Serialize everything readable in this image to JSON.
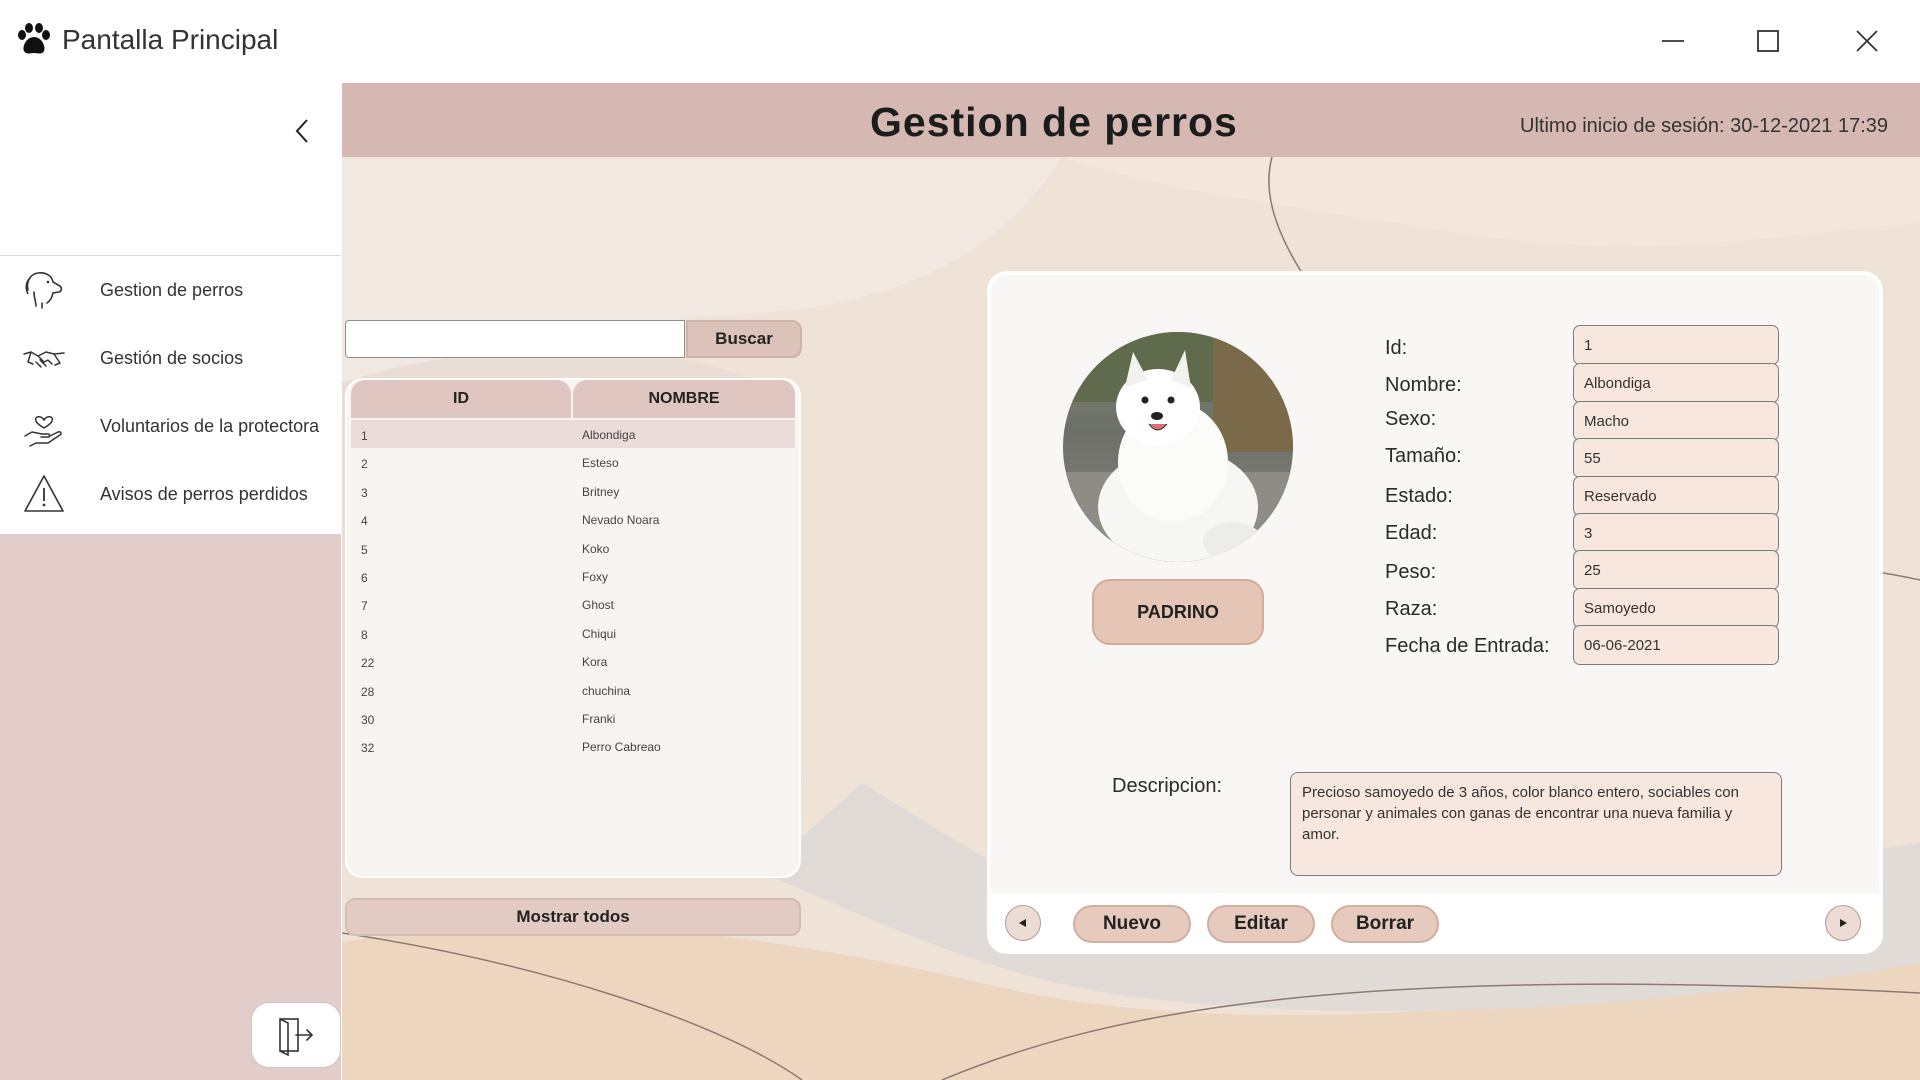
{
  "window": {
    "title": "Pantalla Principal",
    "icons": [
      "paw-icon",
      "minimize-icon",
      "maximize-icon",
      "close-icon"
    ]
  },
  "sidebar": {
    "items": [
      {
        "label": "Gestion de perros",
        "icon": "dog-icon"
      },
      {
        "label": "Gestión de socios",
        "icon": "handshake-icon"
      },
      {
        "label": "Voluntarios de la protectora",
        "icon": "heart-hand-icon"
      },
      {
        "label": "Avisos de perros perdidos",
        "icon": "warning-icon"
      }
    ]
  },
  "header": {
    "title": "Gestion de perros",
    "session": "Ultimo inicio de sesión: 30-12-2021 17:39"
  },
  "search": {
    "value": "",
    "button_label": "Buscar"
  },
  "table": {
    "columns": [
      "ID",
      "NOMBRE"
    ],
    "rows": [
      {
        "id": "1",
        "name": "Albondiga"
      },
      {
        "id": "2",
        "name": "Esteso"
      },
      {
        "id": "3",
        "name": "Britney"
      },
      {
        "id": "4",
        "name": "Nevado Noara"
      },
      {
        "id": "5",
        "name": "Koko"
      },
      {
        "id": "6",
        "name": "Foxy"
      },
      {
        "id": "7",
        "name": "Ghost"
      },
      {
        "id": "8",
        "name": "Chiqui"
      },
      {
        "id": "22",
        "name": "Kora"
      },
      {
        "id": "28",
        "name": "chuchina"
      },
      {
        "id": "30",
        "name": "Franki"
      },
      {
        "id": "32",
        "name": "Perro Cabreao"
      }
    ],
    "selected_index": 0,
    "show_all_label": "Mostrar todos"
  },
  "detail": {
    "padrino_label": "PADRINO",
    "fields": [
      {
        "label": "Id:",
        "value": "1"
      },
      {
        "label": "Nombre:",
        "value": "Albondiga"
      },
      {
        "label": "Sexo:",
        "value": "Macho"
      },
      {
        "label": "Tamaño:",
        "value": "55"
      },
      {
        "label": "Estado:",
        "value": "Reservado"
      },
      {
        "label": "Edad:",
        "value": "3"
      },
      {
        "label": "Peso:",
        "value": "25"
      },
      {
        "label": "Raza:",
        "value": "Samoyedo"
      },
      {
        "label": "Fecha de Entrada:",
        "value": "06-06-2021"
      }
    ],
    "description_label": "Descripcion:",
    "description": "Precioso samoyedo de 3 años, color blanco entero, sociables con personar y animales con ganas de encontrar una nueva familia y amor."
  },
  "actions": {
    "new_label": "Nuevo",
    "edit_label": "Editar",
    "delete_label": "Borrar"
  },
  "colors": {
    "header": "#d5b8b1",
    "sidebar": "#e2cdca",
    "background": "#efe2d6",
    "input_fill": "#f7e7de",
    "button": "#e6cabd"
  }
}
